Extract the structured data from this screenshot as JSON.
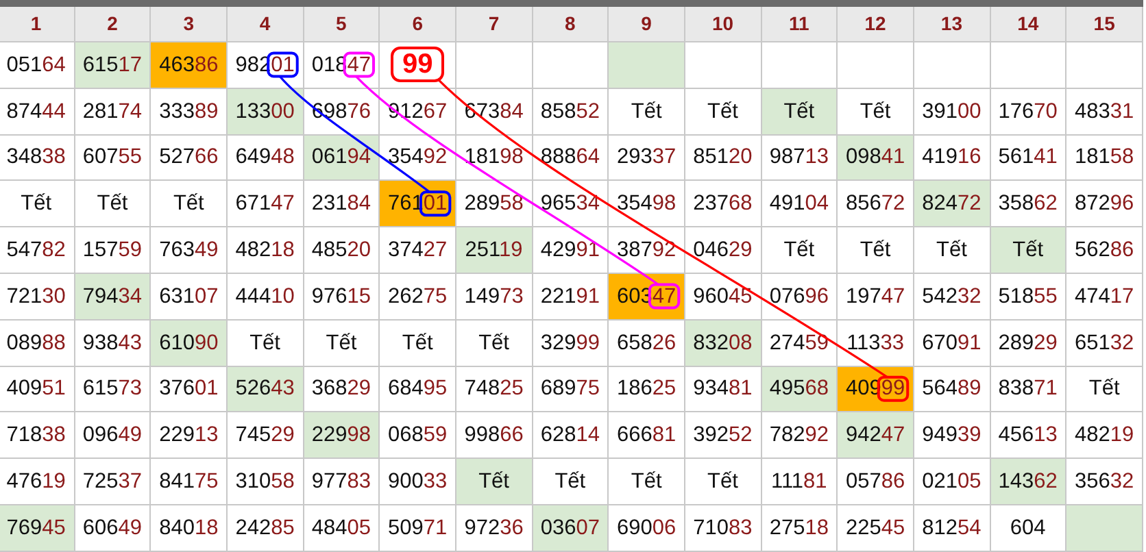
{
  "columns": [
    "1",
    "2",
    "3",
    "4",
    "5",
    "6",
    "7",
    "8",
    "9",
    "10",
    "11",
    "12",
    "13",
    "14",
    "15"
  ],
  "rows": [
    [
      {
        "kind": "number",
        "text": "05164"
      },
      {
        "kind": "number",
        "text": "61517",
        "shaded": true
      },
      {
        "kind": "number",
        "text": "46386",
        "highlighted": true
      },
      {
        "kind": "number",
        "text": "98201",
        "color": "#0000ff"
      },
      {
        "kind": "number",
        "text": "01847",
        "color": "#ff00ff"
      },
      {
        "kind": "label",
        "text": "99",
        "color": "#ff0000"
      },
      {
        "kind": "empty"
      },
      {
        "kind": "empty"
      },
      {
        "kind": "empty",
        "shaded": true
      },
      {
        "kind": "empty"
      },
      {
        "kind": "empty"
      },
      {
        "kind": "empty"
      },
      {
        "kind": "empty"
      },
      {
        "kind": "empty"
      },
      {
        "kind": "empty"
      }
    ],
    [
      {
        "kind": "number",
        "text": "87444"
      },
      {
        "kind": "number",
        "text": "28174"
      },
      {
        "kind": "number",
        "text": "33389"
      },
      {
        "kind": "number",
        "text": "13300",
        "shaded": true
      },
      {
        "kind": "number",
        "text": "69876"
      },
      {
        "kind": "number",
        "text": "91267"
      },
      {
        "kind": "number",
        "text": "67384"
      },
      {
        "kind": "number",
        "text": "85852"
      },
      {
        "kind": "word",
        "text": "Tết"
      },
      {
        "kind": "word",
        "text": "Tết"
      },
      {
        "kind": "word",
        "text": "Tết",
        "shaded": true
      },
      {
        "kind": "word",
        "text": "Tết"
      },
      {
        "kind": "number",
        "text": "39100"
      },
      {
        "kind": "number",
        "text": "17670"
      },
      {
        "kind": "number",
        "text": "48331"
      }
    ],
    [
      {
        "kind": "number",
        "text": "34838"
      },
      {
        "kind": "number",
        "text": "60755"
      },
      {
        "kind": "number",
        "text": "52766"
      },
      {
        "kind": "number",
        "text": "64948"
      },
      {
        "kind": "number",
        "text": "06194",
        "shaded": true
      },
      {
        "kind": "number",
        "text": "35492"
      },
      {
        "kind": "number",
        "text": "18198"
      },
      {
        "kind": "number",
        "text": "88864"
      },
      {
        "kind": "number",
        "text": "29337"
      },
      {
        "kind": "number",
        "text": "85120"
      },
      {
        "kind": "number",
        "text": "98713"
      },
      {
        "kind": "number",
        "text": "09841",
        "shaded": true
      },
      {
        "kind": "number",
        "text": "41916"
      },
      {
        "kind": "number",
        "text": "56141"
      },
      {
        "kind": "number",
        "text": "18158"
      }
    ],
    [
      {
        "kind": "word",
        "text": "Tết"
      },
      {
        "kind": "word",
        "text": "Tết"
      },
      {
        "kind": "word",
        "text": "Tết"
      },
      {
        "kind": "number",
        "text": "67147"
      },
      {
        "kind": "number",
        "text": "23184"
      },
      {
        "kind": "number",
        "text": "76101",
        "highlighted": true,
        "color": "#0000ff"
      },
      {
        "kind": "number",
        "text": "28958"
      },
      {
        "kind": "number",
        "text": "96534"
      },
      {
        "kind": "number",
        "text": "35498"
      },
      {
        "kind": "number",
        "text": "23768"
      },
      {
        "kind": "number",
        "text": "49104"
      },
      {
        "kind": "number",
        "text": "85672"
      },
      {
        "kind": "number",
        "text": "82472",
        "shaded": true
      },
      {
        "kind": "number",
        "text": "35862"
      },
      {
        "kind": "number",
        "text": "87296"
      }
    ],
    [
      {
        "kind": "number",
        "text": "54782"
      },
      {
        "kind": "number",
        "text": "15759"
      },
      {
        "kind": "number",
        "text": "76349"
      },
      {
        "kind": "number",
        "text": "48218"
      },
      {
        "kind": "number",
        "text": "48520"
      },
      {
        "kind": "number",
        "text": "37427"
      },
      {
        "kind": "number",
        "text": "25119",
        "shaded": true
      },
      {
        "kind": "number",
        "text": "42991"
      },
      {
        "kind": "number",
        "text": "38792"
      },
      {
        "kind": "number",
        "text": "04629"
      },
      {
        "kind": "word",
        "text": "Tết"
      },
      {
        "kind": "word",
        "text": "Tết"
      },
      {
        "kind": "word",
        "text": "Tết"
      },
      {
        "kind": "word",
        "text": "Tết",
        "shaded": true
      },
      {
        "kind": "number",
        "text": "56286"
      }
    ],
    [
      {
        "kind": "number",
        "text": "72130"
      },
      {
        "kind": "number",
        "text": "79434",
        "shaded": true
      },
      {
        "kind": "number",
        "text": "63107"
      },
      {
        "kind": "number",
        "text": "44410"
      },
      {
        "kind": "number",
        "text": "97615"
      },
      {
        "kind": "number",
        "text": "26275"
      },
      {
        "kind": "number",
        "text": "14973"
      },
      {
        "kind": "number",
        "text": "22191"
      },
      {
        "kind": "number",
        "text": "60347",
        "highlighted": true,
        "color": "#ff00ff"
      },
      {
        "kind": "number",
        "text": "96045"
      },
      {
        "kind": "number",
        "text": "07696"
      },
      {
        "kind": "number",
        "text": "19747"
      },
      {
        "kind": "number",
        "text": "54232"
      },
      {
        "kind": "number",
        "text": "51855"
      },
      {
        "kind": "number",
        "text": "47417"
      }
    ],
    [
      {
        "kind": "number",
        "text": "08988"
      },
      {
        "kind": "number",
        "text": "93843"
      },
      {
        "kind": "number",
        "text": "61090",
        "shaded": true
      },
      {
        "kind": "word",
        "text": "Tết"
      },
      {
        "kind": "word",
        "text": "Tết"
      },
      {
        "kind": "word",
        "text": "Tết"
      },
      {
        "kind": "word",
        "text": "Tết"
      },
      {
        "kind": "number",
        "text": "32999"
      },
      {
        "kind": "number",
        "text": "65826"
      },
      {
        "kind": "number",
        "text": "83208",
        "shaded": true
      },
      {
        "kind": "number",
        "text": "27459"
      },
      {
        "kind": "number",
        "text": "11333"
      },
      {
        "kind": "number",
        "text": "67091"
      },
      {
        "kind": "number",
        "text": "28929"
      },
      {
        "kind": "number",
        "text": "65132"
      }
    ],
    [
      {
        "kind": "number",
        "text": "40951"
      },
      {
        "kind": "number",
        "text": "61573"
      },
      {
        "kind": "number",
        "text": "37601"
      },
      {
        "kind": "number",
        "text": "52643",
        "shaded": true
      },
      {
        "kind": "number",
        "text": "36829"
      },
      {
        "kind": "number",
        "text": "68495"
      },
      {
        "kind": "number",
        "text": "74825"
      },
      {
        "kind": "number",
        "text": "68975"
      },
      {
        "kind": "number",
        "text": "18625"
      },
      {
        "kind": "number",
        "text": "93481"
      },
      {
        "kind": "number",
        "text": "49568",
        "shaded": true
      },
      {
        "kind": "number",
        "text": "40999",
        "highlighted": true,
        "color": "#ff0000"
      },
      {
        "kind": "number",
        "text": "56489"
      },
      {
        "kind": "number",
        "text": "83871"
      },
      {
        "kind": "word",
        "text": "Tết"
      }
    ],
    [
      {
        "kind": "number",
        "text": "71838"
      },
      {
        "kind": "number",
        "text": "09649"
      },
      {
        "kind": "number",
        "text": "22913"
      },
      {
        "kind": "number",
        "text": "74529"
      },
      {
        "kind": "number",
        "text": "22998",
        "shaded": true
      },
      {
        "kind": "number",
        "text": "06859"
      },
      {
        "kind": "number",
        "text": "99866"
      },
      {
        "kind": "number",
        "text": "62814"
      },
      {
        "kind": "number",
        "text": "66681"
      },
      {
        "kind": "number",
        "text": "39252"
      },
      {
        "kind": "number",
        "text": "78292"
      },
      {
        "kind": "number",
        "text": "94247",
        "shaded": true
      },
      {
        "kind": "number",
        "text": "94939"
      },
      {
        "kind": "number",
        "text": "45613"
      },
      {
        "kind": "number",
        "text": "48219"
      }
    ],
    [
      {
        "kind": "number",
        "text": "47619"
      },
      {
        "kind": "number",
        "text": "72537"
      },
      {
        "kind": "number",
        "text": "84175"
      },
      {
        "kind": "number",
        "text": "31058"
      },
      {
        "kind": "number",
        "text": "97783"
      },
      {
        "kind": "number",
        "text": "90033"
      },
      {
        "kind": "word",
        "text": "Tết",
        "shaded": true
      },
      {
        "kind": "word",
        "text": "Tết"
      },
      {
        "kind": "word",
        "text": "Tết"
      },
      {
        "kind": "word",
        "text": "Tết"
      },
      {
        "kind": "number",
        "text": "11181"
      },
      {
        "kind": "number",
        "text": "05786"
      },
      {
        "kind": "number",
        "text": "02105"
      },
      {
        "kind": "number",
        "text": "14362",
        "shaded": true
      },
      {
        "kind": "number",
        "text": "35632"
      }
    ],
    [
      {
        "kind": "number",
        "text": "76945",
        "shaded": true
      },
      {
        "kind": "number",
        "text": "60649"
      },
      {
        "kind": "number",
        "text": "84018"
      },
      {
        "kind": "number",
        "text": "24285"
      },
      {
        "kind": "number",
        "text": "48405"
      },
      {
        "kind": "number",
        "text": "50971"
      },
      {
        "kind": "number",
        "text": "97236"
      },
      {
        "kind": "number",
        "text": "03607",
        "shaded": true
      },
      {
        "kind": "number",
        "text": "69006"
      },
      {
        "kind": "number",
        "text": "71083"
      },
      {
        "kind": "number",
        "text": "27518"
      },
      {
        "kind": "number",
        "text": "22545"
      },
      {
        "kind": "number",
        "text": "81254"
      },
      {
        "kind": "number",
        "text": "604"
      },
      {
        "kind": "empty",
        "shaded": true
      }
    ]
  ]
}
